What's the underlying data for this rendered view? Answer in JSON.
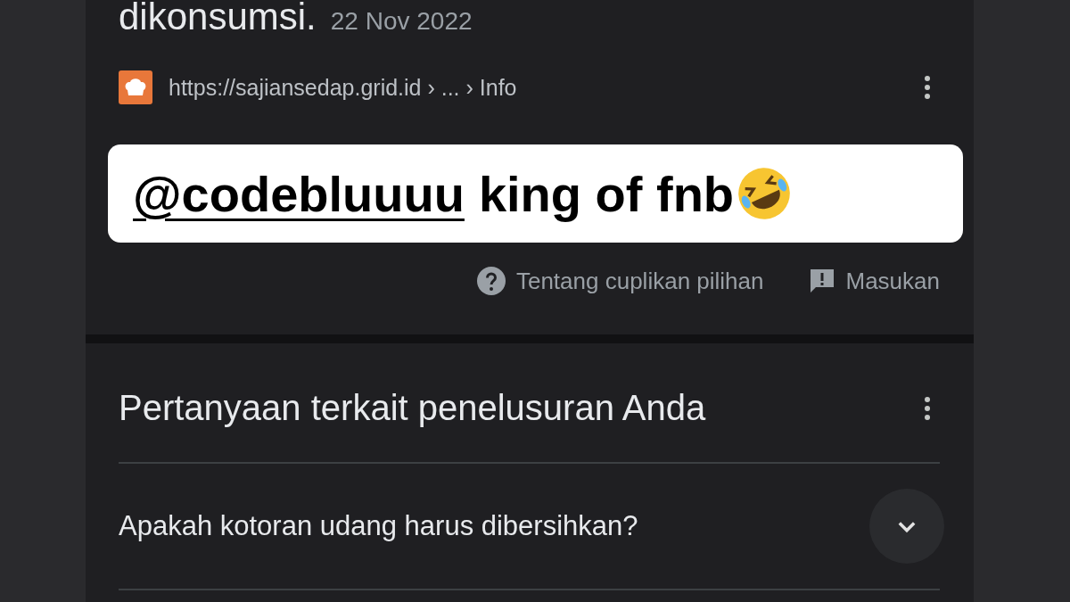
{
  "snippet": {
    "text_end": "dikonsumsi.",
    "date": "22 Nov 2022"
  },
  "source": {
    "url": "https://sajiansedap.grid.id › ... › Info"
  },
  "sticker": {
    "mention": "@codebluuuu",
    "text": "king of fnb"
  },
  "snippet_footer": [
    {
      "kind": "help",
      "label": "Tentang cuplikan pilihan"
    },
    {
      "kind": "feedback",
      "label": "Masukan"
    }
  ],
  "related_questions": {
    "title": "Pertanyaan terkait penelusuran Anda",
    "items": [
      {
        "question": "Apakah kotoran udang harus dibersihkan?",
        "expanded": false
      }
    ]
  }
}
